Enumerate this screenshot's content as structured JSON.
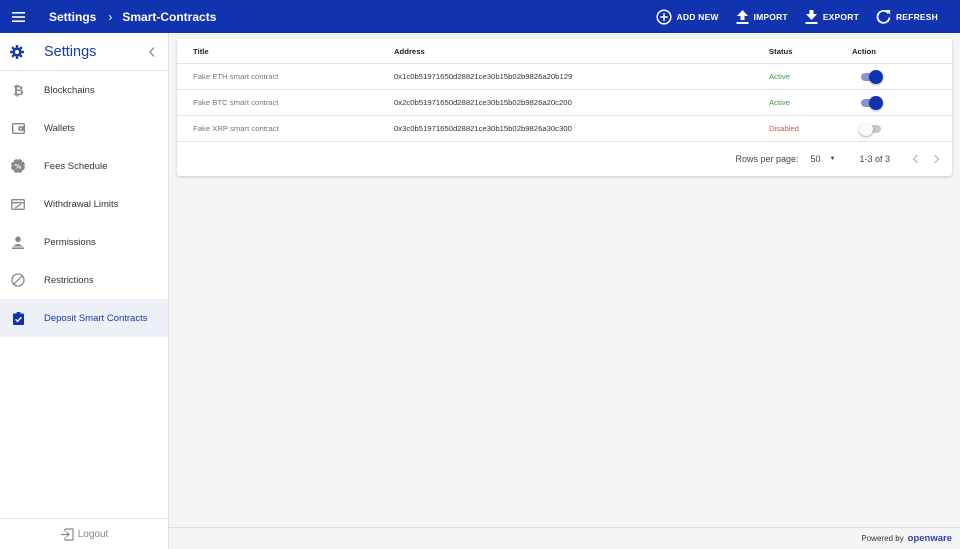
{
  "header": {
    "breadcrumb_root": "Settings",
    "breadcrumb_sep": "›",
    "breadcrumb_current": "Smart-Contracts",
    "menu_icon": "hamburger-icon",
    "actions": {
      "add_new": "ADD NEW",
      "import": "IMPORT",
      "export": "EXPORT",
      "refresh": "REFRESH"
    },
    "bar_color": "#1133b0"
  },
  "sidebar": {
    "title": "Settings",
    "items": [
      {
        "label": "Blockchains",
        "icon": "bitcoin-icon"
      },
      {
        "label": "Wallets",
        "icon": "wallet-icon"
      },
      {
        "label": "Fees Schedule",
        "icon": "badge-percent-icon"
      },
      {
        "label": "Withdrawal Limits",
        "icon": "card-limit-icon"
      },
      {
        "label": "Permissions",
        "icon": "person-icon"
      },
      {
        "label": "Restrictions",
        "icon": "block-icon"
      },
      {
        "label": "Deposit Smart Contracts",
        "icon": "clipboard-check-icon",
        "active": true
      }
    ],
    "logout": "Logout"
  },
  "table": {
    "columns": {
      "title": "Title",
      "address": "Address",
      "status": "Status",
      "action": "Action"
    },
    "rows": [
      {
        "title": "Fake ETH smart contract",
        "address": "0x1c0b51971650d28821ce30b15b02b9826a20b129",
        "status": "Active",
        "enabled": true
      },
      {
        "title": "Fake BTC smart contract",
        "address": "0x2c0b51971650d28821ce30b15b02b9826a20c200",
        "status": "Active",
        "enabled": true
      },
      {
        "title": "Fake XRP smart contract",
        "address": "0x3c0b51971650d28821ce30b15b02b9826a30c300",
        "status": "Disabled",
        "enabled": false
      }
    ],
    "pagination": {
      "rows_per_page_label": "Rows per page:",
      "rows_per_page": "50",
      "range": "1-3 of 3"
    }
  },
  "footer": {
    "powered_by": "Powered by",
    "brand": "openware"
  }
}
